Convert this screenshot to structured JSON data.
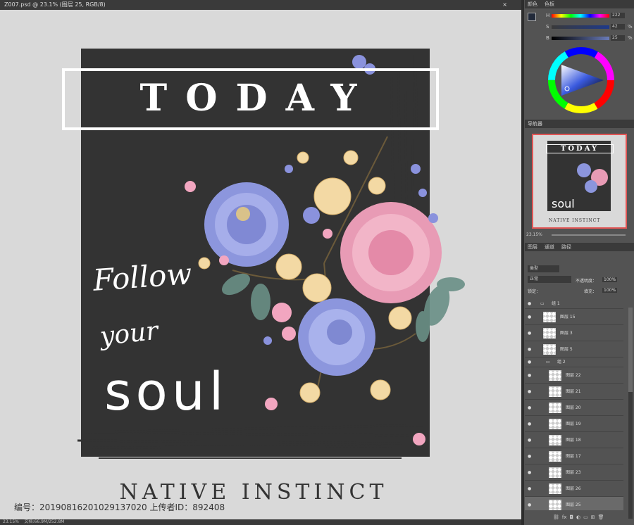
{
  "document": {
    "tab_title": "Z007.psd @ 23.1% (图层 25, RGB/8)",
    "close_glyph": "×"
  },
  "window_buttons": [
    "—",
    "□",
    "×"
  ],
  "artwork": {
    "headline": "TODAY",
    "script_line1": "Follow",
    "script_line2": "your",
    "big_word": "soul",
    "footer": "NATIVE INSTINCT"
  },
  "watermark": {
    "caption": "编号：20190816201029137020 上传者ID：892408"
  },
  "status_bar": {
    "zoom": "23.15%",
    "doc_info": "文档:66.9M/252.8M"
  },
  "color_panel": {
    "tabs": [
      "颜色",
      "色板"
    ],
    "sliders": [
      {
        "label": "H",
        "value": "222",
        "unit": ""
      },
      {
        "label": "S",
        "value": "42",
        "unit": "%"
      },
      {
        "label": "B",
        "value": "25",
        "unit": "%"
      }
    ]
  },
  "navigator_panel": {
    "tab": "导航器",
    "zoom": "23.15%",
    "preview_headline": "TODAY",
    "preview_soul": "soul",
    "preview_footer": "NATIVE INSTINCT"
  },
  "layers_panel": {
    "tabs": [
      "图层",
      "通道",
      "路径"
    ],
    "filter_label": "类型",
    "blend_mode": "正常",
    "opacity_label": "不透明度：",
    "opacity_value": "100%",
    "lock_label": "锁定：",
    "fill_label": "填充：",
    "fill_value": "100%",
    "rows": [
      {
        "name": "组 1",
        "kind": "group"
      },
      {
        "name": "图层 15",
        "kind": "layer"
      },
      {
        "name": "图层 3",
        "kind": "layer"
      },
      {
        "name": "图层 5",
        "kind": "layer"
      },
      {
        "name": "组 2",
        "kind": "group"
      },
      {
        "name": "图层 22",
        "kind": "layer"
      },
      {
        "name": "图层 21",
        "kind": "layer"
      },
      {
        "name": "图层 20",
        "kind": "layer"
      },
      {
        "name": "图层 19",
        "kind": "layer"
      },
      {
        "name": "图层 18",
        "kind": "layer"
      },
      {
        "name": "图层 17",
        "kind": "layer"
      },
      {
        "name": "图层 23",
        "kind": "layer"
      },
      {
        "name": "图层 26",
        "kind": "layer"
      },
      {
        "name": "图层 25",
        "kind": "layer"
      }
    ],
    "footer_icons": [
      "link-icon",
      "fx-icon",
      "mask-icon",
      "adjustment-icon",
      "folder-icon",
      "new-layer-icon",
      "trash-icon"
    ]
  },
  "colors": {
    "canvas_bg": "#d9d9d9",
    "artwork_dark": "#333333",
    "panel_bg": "#535353",
    "panel_header": "#3a3a3a",
    "text_white": "#ffffff"
  }
}
